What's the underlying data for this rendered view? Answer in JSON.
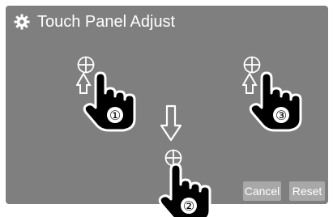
{
  "header": {
    "title": "Touch Panel Adjust",
    "icon": "gear-icon"
  },
  "points": [
    {
      "label": "①",
      "icon": "crosshair-icon"
    },
    {
      "label": "②",
      "icon": "crosshair-icon"
    },
    {
      "label": "③",
      "icon": "crosshair-icon"
    }
  ],
  "buttons": {
    "cancel_label": "Cancel",
    "reset_label": "Reset"
  },
  "colors": {
    "screen_bg": "#7f7f7f",
    "text": "#ffffff",
    "button_bg": "#a8a8a8"
  }
}
